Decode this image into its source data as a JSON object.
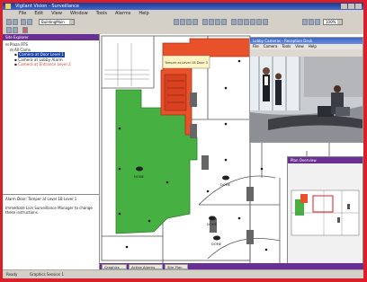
{
  "window": {
    "title": "Vigilant Vision - Surveillance"
  },
  "menu": [
    "File",
    "Edit",
    "View",
    "Window",
    "Tools",
    "Alarms",
    "Help"
  ],
  "toolbar": {
    "building_label": "BuildingMain",
    "zoom_label": "100%"
  },
  "tree": {
    "header": "Site Explorer",
    "items": [
      {
        "label": "Plaza RTS",
        "level": 0,
        "style": "normal"
      },
      {
        "label": "All Cams",
        "level": 1,
        "style": "normal"
      },
      {
        "label": "Camera at Door Level 1",
        "level": 2,
        "style": "hl"
      },
      {
        "label": "Camera at Lobby Alarm",
        "level": 2,
        "style": "normal"
      },
      {
        "label": "Camera at Entrance Level 2",
        "level": 2,
        "style": "red"
      }
    ]
  },
  "info_panel": {
    "text": "Alarm Door: Tamper at Level 1B Level 1",
    "text2": "Immediate Live Surveillance Manager to change these instructions."
  },
  "map": {
    "dome_labels": [
      "DOME",
      "DOME",
      "DOME",
      "DOME"
    ],
    "alarm_callout": "Tamper at Level 1B Door 3",
    "colors": {
      "green_zone": "#46b142",
      "alarm_zone": "#e8512a"
    }
  },
  "video": {
    "title": "Lobby Cameras - Reception Desk",
    "menu": [
      "File",
      "Camera",
      "Tools",
      "View",
      "Help"
    ]
  },
  "minimap": {
    "title": "Plan Overview"
  },
  "tabs": [
    "Graphics",
    "Active Alarms",
    "Site Plan"
  ],
  "status": {
    "left": "Ready",
    "center": "Graphics Session 1"
  }
}
